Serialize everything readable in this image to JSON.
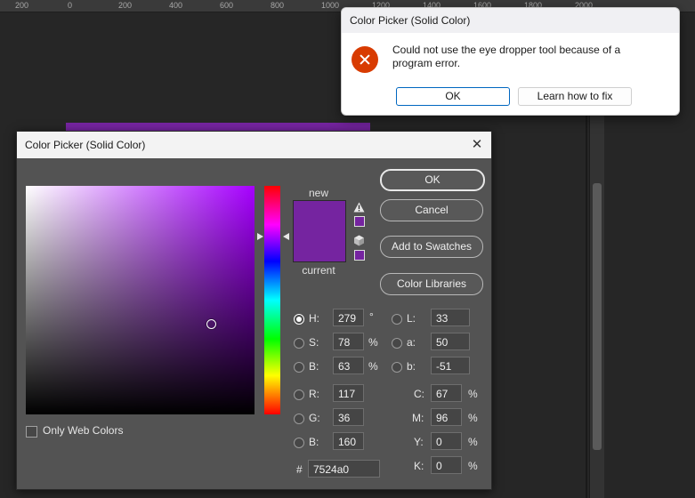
{
  "ruler": {
    "labels": [
      "200",
      "0",
      "200",
      "400",
      "600",
      "800",
      "1000",
      "1200",
      "1400",
      "1600",
      "1800",
      "2000"
    ]
  },
  "colors": {
    "current_color": "#7524a0",
    "new_color": "#7524a0",
    "error_accent": "#d83b01",
    "button_accent": "#0067c0"
  },
  "error_dialog": {
    "title": "Color Picker (Solid Color)",
    "icon": "error-icon",
    "message": "Could not use the eye dropper tool because of a program error.",
    "ok_label": "OK",
    "learn_label": "Learn how to fix"
  },
  "color_picker": {
    "title": "Color Picker (Solid Color)",
    "close_icon": "close-icon",
    "new_label": "new",
    "current_label": "current",
    "buttons": {
      "ok": "OK",
      "cancel": "Cancel",
      "add_to_swatches": "Add to Swatches",
      "color_libraries": "Color Libraries"
    },
    "only_web_colors": "Only Web Colors",
    "only_web_colors_checked": false,
    "selected_channel": "H",
    "hsb": {
      "h_label": "H:",
      "h": "279",
      "h_unit": "°",
      "s_label": "S:",
      "s": "78",
      "s_unit": "%",
      "b_label": "B:",
      "b": "63",
      "b_unit": "%"
    },
    "rgb": {
      "r_label": "R:",
      "r": "117",
      "g_label": "G:",
      "g": "36",
      "b_label": "B:",
      "b": "160"
    },
    "lab": {
      "l_label": "L:",
      "l": "33",
      "a_label": "a:",
      "a": "50",
      "b_label": "b:",
      "b": "-51"
    },
    "cmyk": {
      "c_label": "C:",
      "c": "67",
      "c_unit": "%",
      "m_label": "M:",
      "m": "96",
      "m_unit": "%",
      "y_label": "Y:",
      "y": "0",
      "y_unit": "%",
      "k_label": "K:",
      "k": "0",
      "k_unit": "%"
    },
    "hex_label": "#",
    "hex": "7524a0"
  }
}
